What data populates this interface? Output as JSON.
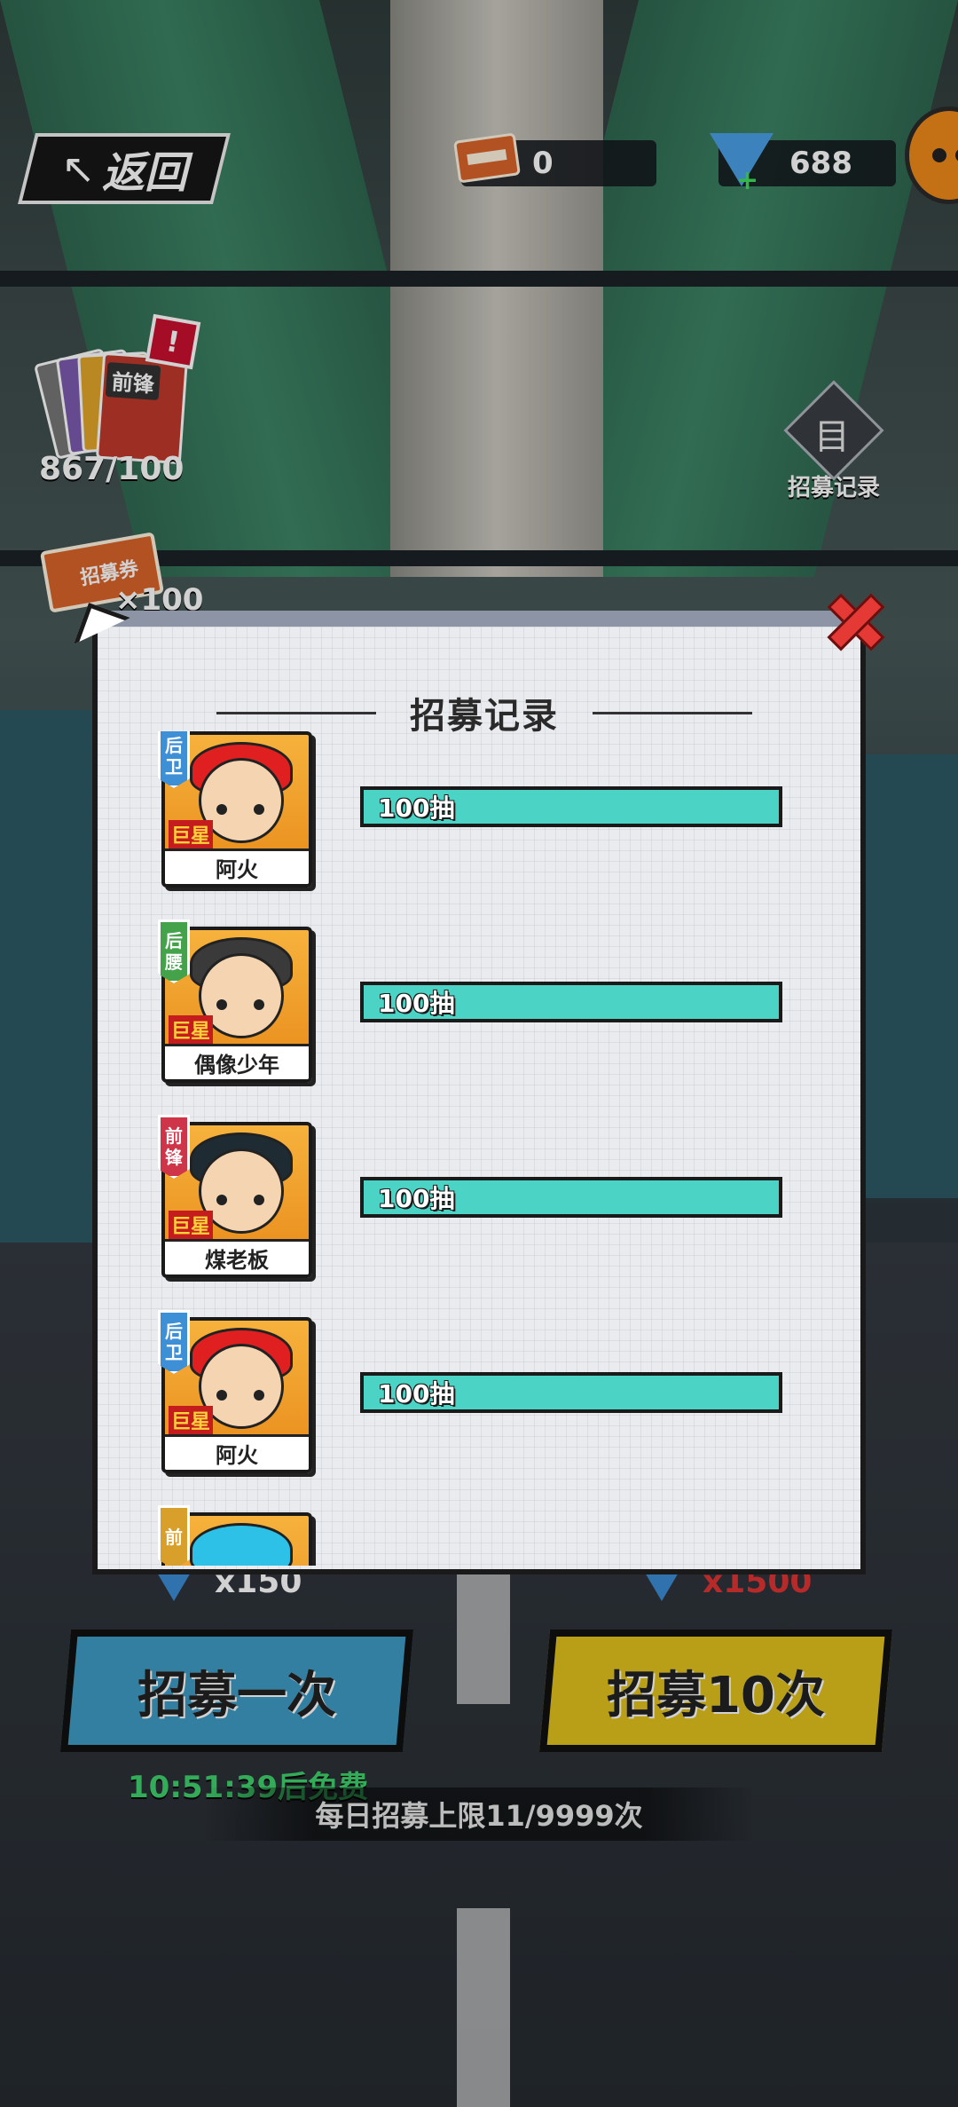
{
  "header": {
    "back_label": "返回",
    "tickets": "0",
    "gems": "688"
  },
  "side_widgets": {
    "cards_label": "前锋",
    "cards_alert": "!",
    "cards_count": "867/100",
    "ticket_label": "招募券",
    "ticket_multiplier": "×100",
    "record_label": "招募记录"
  },
  "modal": {
    "title": "招募记录",
    "records": [
      {
        "position": [
          "后",
          "卫"
        ],
        "position_color": "blue",
        "rank": "巨星",
        "name": "阿火",
        "pulls": "100抽",
        "hair": "red"
      },
      {
        "position": [
          "后",
          "腰"
        ],
        "position_color": "green",
        "rank": "巨星",
        "name": "偶像少年",
        "pulls": "100抽",
        "hair": "dark"
      },
      {
        "position": [
          "前",
          "锋"
        ],
        "position_color": "red",
        "rank": "巨星",
        "name": "煤老板",
        "pulls": "100抽",
        "hair": "black"
      },
      {
        "position": [
          "后",
          "卫"
        ],
        "position_color": "blue",
        "rank": "巨星",
        "name": "阿火",
        "pulls": "100抽",
        "hair": "red"
      },
      {
        "position": [
          "前",
          ""
        ],
        "position_color": "gold",
        "rank": "",
        "name": "",
        "pulls": "",
        "hair": "blue"
      }
    ]
  },
  "footer": {
    "once_cost": "x150",
    "ten_cost": "x1500",
    "once_label": "招募一次",
    "ten_label": "招募10次",
    "free_timer": "10:51:39后免费",
    "daily_limit": "每日招募上限11/9999次"
  },
  "colors": {
    "pulls_bar": "#4bd3c5",
    "once_button": "#3d9bc6",
    "ten_button": "#e2c21d",
    "timer": "#3fd16d",
    "close": "#e53935"
  }
}
